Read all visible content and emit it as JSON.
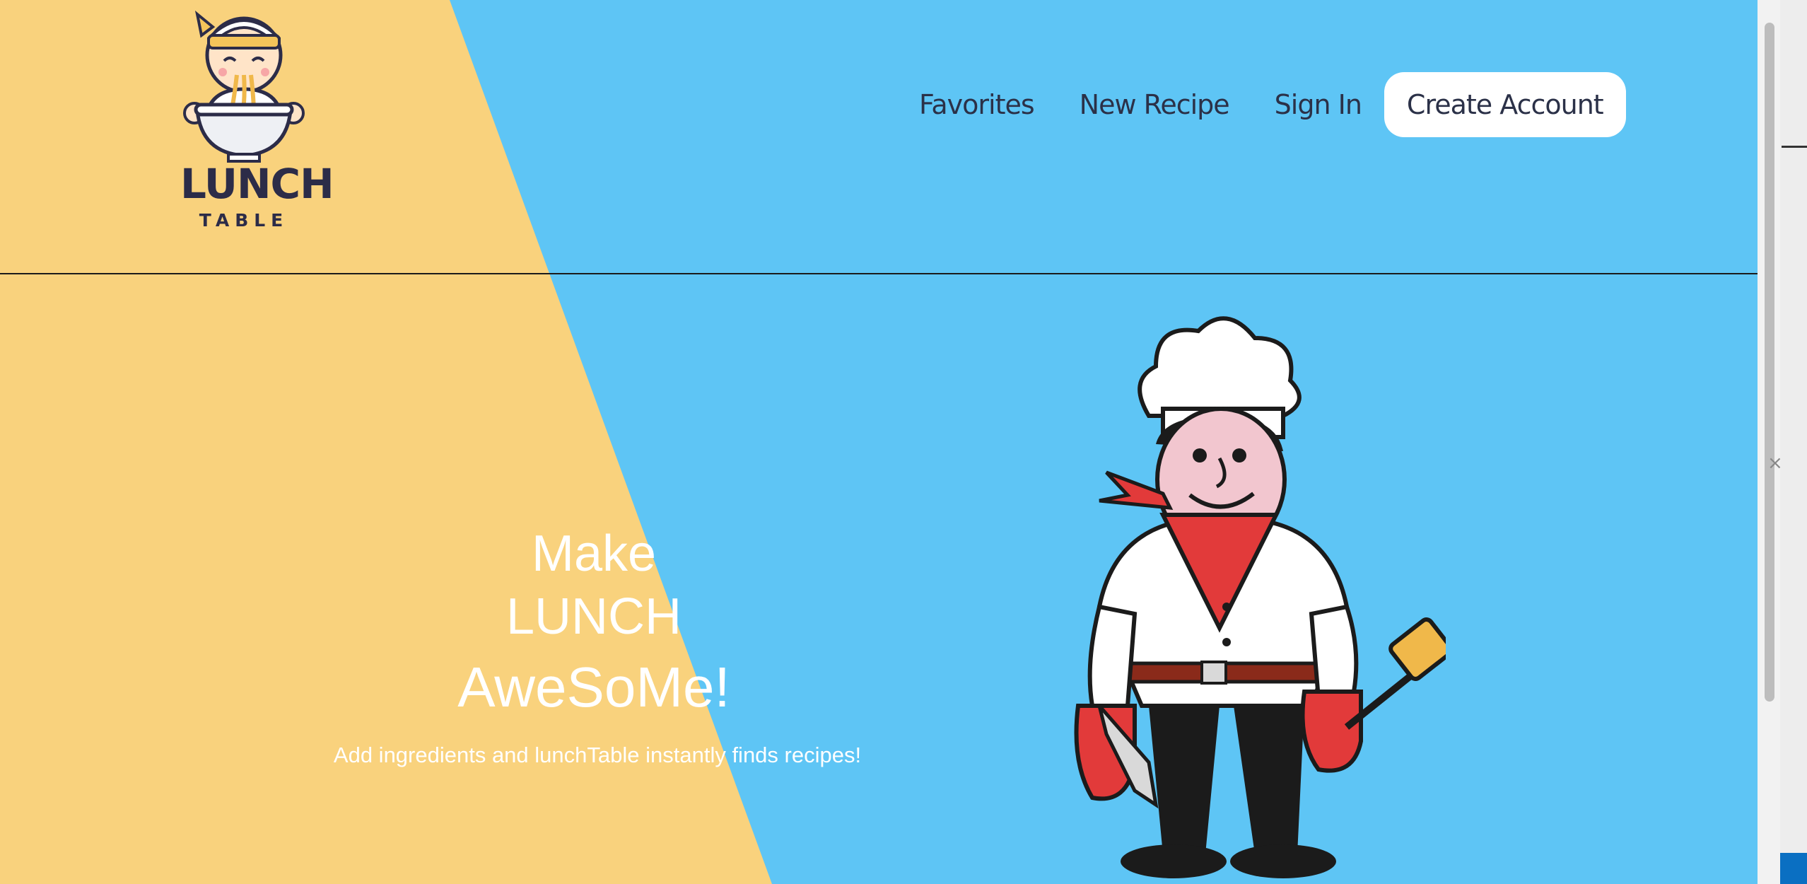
{
  "brand": {
    "name": "LUNCH",
    "subname": "TABLE"
  },
  "nav": {
    "favorites": "Favorites",
    "new_recipe": "New Recipe",
    "sign_in": "Sign In",
    "create_account": "Create Account"
  },
  "hero": {
    "line1": "Make",
    "line2": "LUNCH",
    "line3": "AweSoMe!",
    "subtitle": "Add ingredients and lunchTable instantly finds recipes!"
  },
  "colors": {
    "sky": "#5ec5f5",
    "sand": "#f9d27d",
    "text_dark": "#2b3148",
    "white": "#ffffff",
    "chef_red": "#e23a3a"
  },
  "icons": {
    "logo": "lunch-table-logo-icon",
    "hero_image": "chef-illustration",
    "close": "close-icon"
  }
}
